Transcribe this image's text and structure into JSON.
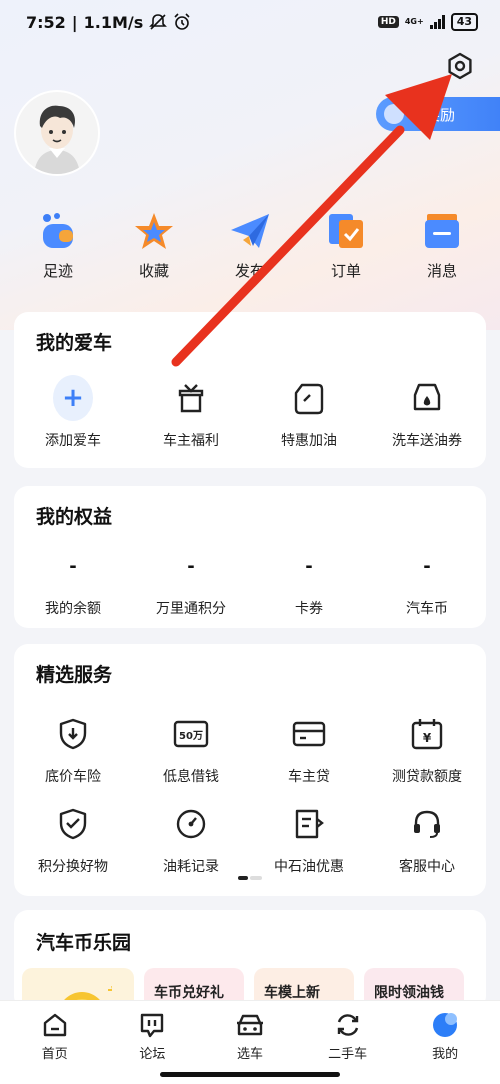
{
  "status": {
    "time": "7:52",
    "speed": "1.1M/s",
    "hd": "HD",
    "network": "4G+",
    "battery": "43"
  },
  "header": {
    "reward_label": "领奖励"
  },
  "quick": [
    {
      "label": "足迹",
      "icon": "footprint-icon"
    },
    {
      "label": "收藏",
      "icon": "star-icon"
    },
    {
      "label": "发布",
      "icon": "paper-plane-icon"
    },
    {
      "label": "订单",
      "icon": "order-icon"
    },
    {
      "label": "消息",
      "icon": "message-icon"
    }
  ],
  "my_car": {
    "title": "我的爱车",
    "items": [
      {
        "label": "添加爱车",
        "icon": "plus-icon"
      },
      {
        "label": "车主福利",
        "icon": "gift-icon"
      },
      {
        "label": "特惠加油",
        "icon": "fuel-can-icon"
      },
      {
        "label": "洗车送油券",
        "icon": "car-wash-icon"
      }
    ]
  },
  "equity": {
    "title": "我的权益",
    "items": [
      {
        "value": "-",
        "label": "我的余额"
      },
      {
        "value": "-",
        "label": "万里通积分"
      },
      {
        "value": "-",
        "label": "卡券"
      },
      {
        "value": "-",
        "label": "汽车币"
      }
    ]
  },
  "services": {
    "title": "精选服务",
    "row1": [
      {
        "label": "底价车险",
        "icon": "shield-down-icon"
      },
      {
        "label": "低息借钱",
        "icon": "money-50-icon",
        "badge": "50万"
      },
      {
        "label": "车主贷",
        "icon": "card-icon"
      },
      {
        "label": "测贷款额度",
        "icon": "calendar-yuan-icon",
        "badge": "¥"
      }
    ],
    "row2": [
      {
        "label": "积分换好物",
        "icon": "shield-check-icon"
      },
      {
        "label": "油耗记录",
        "icon": "gauge-icon"
      },
      {
        "label": "中石油优惠",
        "icon": "receipt-icon"
      },
      {
        "label": "客服中心",
        "icon": "headset-icon"
      }
    ]
  },
  "park": {
    "title": "汽车币乐园",
    "tiles": [
      {
        "label": "车币兑好礼"
      },
      {
        "label": "车模上新"
      },
      {
        "label": "限时领油钱"
      }
    ]
  },
  "tabs": [
    {
      "label": "首页",
      "icon": "home-icon"
    },
    {
      "label": "论坛",
      "icon": "forum-icon"
    },
    {
      "label": "选车",
      "icon": "car-icon"
    },
    {
      "label": "二手车",
      "icon": "refresh-icon"
    },
    {
      "label": "我的",
      "icon": "profile-icon"
    }
  ],
  "colors": {
    "accent": "#3d7ff7",
    "arrow": "#e8321e"
  }
}
